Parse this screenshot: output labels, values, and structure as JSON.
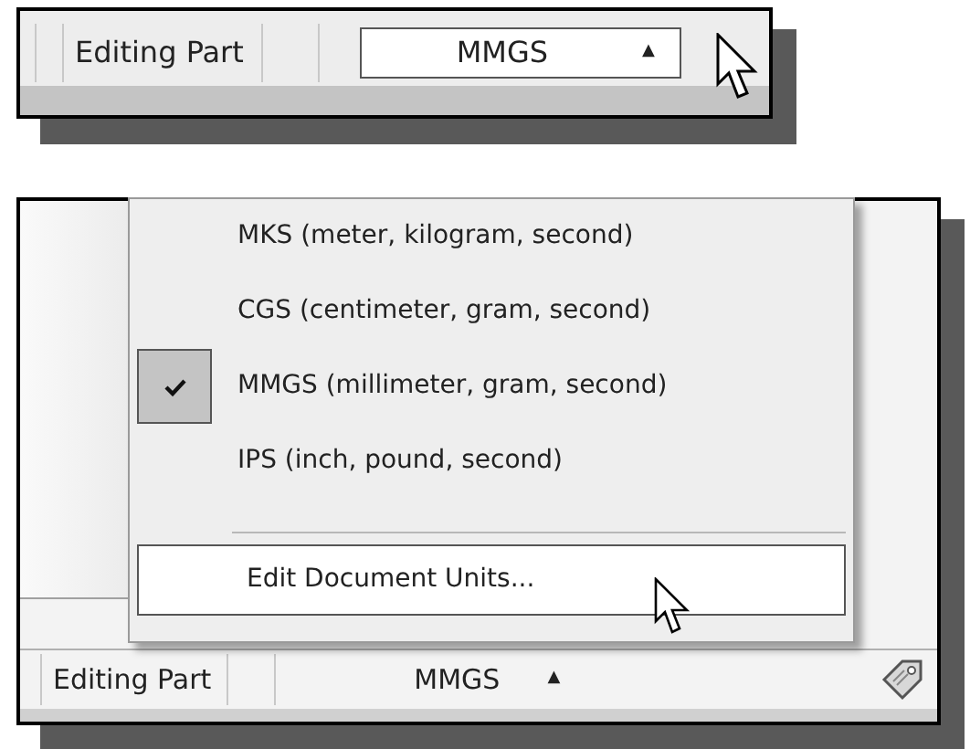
{
  "top_status_bar": {
    "mode": "Editing Part",
    "units": "MMGS",
    "units_arrow": "▲",
    "units_hovered": true
  },
  "bottom_view": {
    "units_menu": {
      "items": [
        {
          "label": "MKS (meter, kilogram, second)",
          "selected": false
        },
        {
          "label": "CGS (centimeter, gram, second)",
          "selected": false
        },
        {
          "label": "MMGS (millimeter, gram, second)",
          "selected": true
        },
        {
          "label": "IPS (inch, pound, second)",
          "selected": false
        }
      ],
      "edit_item": {
        "label": "Edit Document Units...",
        "hovered": true
      }
    },
    "status_bar": {
      "mode": "Editing Part",
      "units": "MMGS",
      "units_arrow": "▲",
      "units_hovered": false
    }
  }
}
